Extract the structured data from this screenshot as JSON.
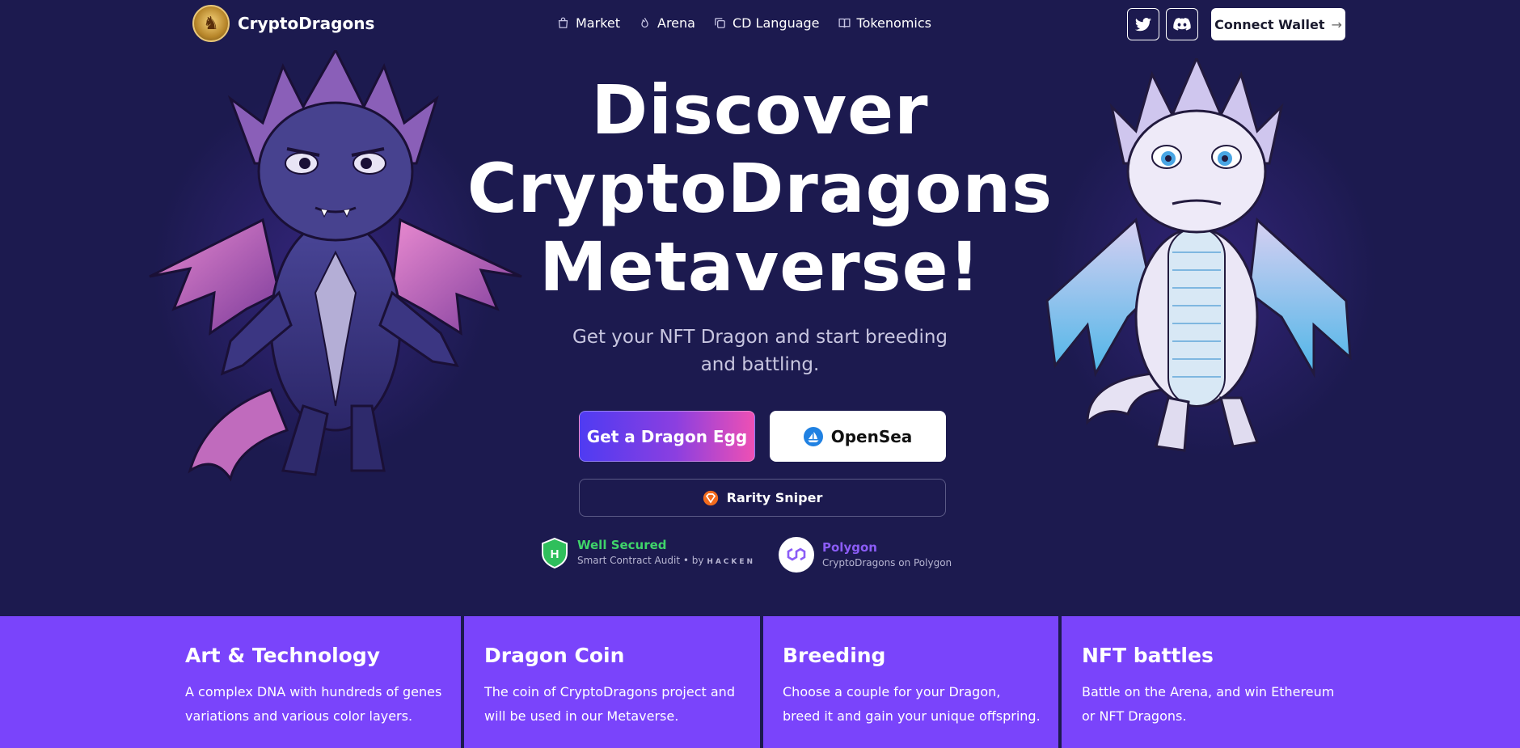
{
  "brand": {
    "name": "CryptoDragons",
    "logo_icon": "dragon-logo-icon"
  },
  "nav": {
    "items": [
      {
        "label": "Market",
        "icon": "shopping-bag-icon"
      },
      {
        "label": "Arena",
        "icon": "flame-icon"
      },
      {
        "label": "CD Language",
        "icon": "copy-icon"
      },
      {
        "label": "Tokenomics",
        "icon": "book-icon"
      }
    ],
    "social": [
      {
        "name": "Twitter",
        "icon": "twitter-icon"
      },
      {
        "name": "Discord",
        "icon": "discord-icon"
      }
    ],
    "connect_label": "Connect Wallet",
    "connect_arrow": "→"
  },
  "hero": {
    "headline": [
      "Discover",
      "CryptoDragons",
      "Metaverse!"
    ],
    "subtitle": "Get your NFT Dragon and start breeding and battling.",
    "cta_primary": "Get a Dragon Egg",
    "cta_secondary": "OpenSea",
    "cta_tertiary": "Rarity Sniper"
  },
  "badges": {
    "security": {
      "title": "Well Secured",
      "sub": "Smart Contract Audit",
      "by": "by",
      "partner": "HACKEN",
      "title_color": "#3fd46a"
    },
    "polygon": {
      "title": "Polygon",
      "sub": "CryptoDragons on Polygon",
      "title_color": "#8b5cf6"
    }
  },
  "features": [
    {
      "title": "Art & Technology",
      "text": "A complex DNA with hundreds of genes variations and various color layers."
    },
    {
      "title": "Dragon Coin",
      "text": "The coin of CryptoDragons project and will be used in our Metaverse."
    },
    {
      "title": "Breeding",
      "text": "Choose a couple for your Dragon, breed it and gain your unique offspring."
    },
    {
      "title": "NFT battles",
      "text": "Battle on the Arena, and win Ethereum or NFT Dragons."
    }
  ],
  "colors": {
    "background": "#1c1a4f",
    "feature_band": "#7a44fb",
    "accent_pink": "#ee50b4",
    "accent_blue": "#4f3bf2"
  }
}
